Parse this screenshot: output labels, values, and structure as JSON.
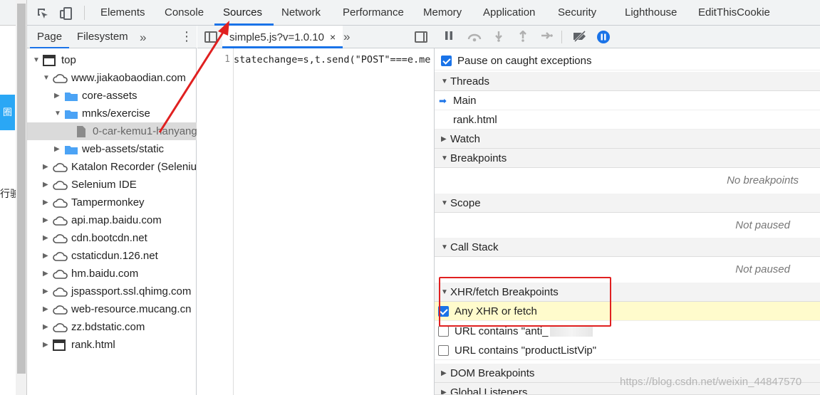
{
  "page_strip": {
    "blue_tab_text": "圈",
    "cut_text": "行驶"
  },
  "main_toolbar": {
    "tabs": [
      "Elements",
      "Console",
      "Sources",
      "Network",
      "Performance",
      "Memory",
      "Application",
      "Security",
      "Lighthouse",
      "EditThisCookie"
    ],
    "active_tab": "Sources"
  },
  "navigator": {
    "tabs": [
      "Page",
      "Filesystem"
    ],
    "active_tab": "Page",
    "more_icon": "»",
    "menu_icon": "⋮",
    "tree": [
      {
        "label": "top",
        "icon": "frame-icon",
        "expanded": true
      },
      {
        "label": "www.jiakaobaodian.com",
        "icon": "cloud-icon",
        "expanded": true
      },
      {
        "label": "core-assets",
        "icon": "folder-icon",
        "expanded": false
      },
      {
        "label": "mnks/exercise",
        "icon": "folder-icon",
        "expanded": true
      },
      {
        "label": "0-car-kemu1-hanyang",
        "icon": "file-icon",
        "selected": true
      },
      {
        "label": "web-assets/static",
        "icon": "folder-icon",
        "expanded": false
      },
      {
        "label": "Katalon Recorder (Selenium",
        "icon": "cloud-icon",
        "expanded": false
      },
      {
        "label": "Selenium IDE",
        "icon": "cloud-icon",
        "expanded": false
      },
      {
        "label": "Tampermonkey",
        "icon": "cloud-icon",
        "expanded": false
      },
      {
        "label": "api.map.baidu.com",
        "icon": "cloud-icon",
        "expanded": false
      },
      {
        "label": "cdn.bootcdn.net",
        "icon": "cloud-icon",
        "expanded": false
      },
      {
        "label": "cstaticdun.126.net",
        "icon": "cloud-icon",
        "expanded": false
      },
      {
        "label": "hm.baidu.com",
        "icon": "cloud-icon",
        "expanded": false
      },
      {
        "label": "jspassport.ssl.qhimg.com",
        "icon": "cloud-icon",
        "expanded": false
      },
      {
        "label": "web-resource.mucang.cn",
        "icon": "cloud-icon",
        "expanded": false
      },
      {
        "label": "zz.bdstatic.com",
        "icon": "cloud-icon",
        "expanded": false
      },
      {
        "label": "rank.html",
        "icon": "frame-icon",
        "expanded": false
      }
    ]
  },
  "editor": {
    "file_tab": "simple5.js?v=1.0.10",
    "close_icon": "×",
    "more_icon": "»",
    "line_number": "1",
    "code": "statechange=s,t.send(\"POST\"===e.me"
  },
  "debugger": {
    "pause_on_caught": {
      "label": "Pause on caught exceptions",
      "checked": true
    },
    "threads": {
      "title": "Threads",
      "items": [
        "Main",
        "rank.html"
      ]
    },
    "watch": {
      "title": "Watch"
    },
    "breakpoints": {
      "title": "Breakpoints",
      "empty": "No breakpoints"
    },
    "scope": {
      "title": "Scope",
      "empty": "Not paused"
    },
    "call_stack": {
      "title": "Call Stack",
      "empty": "Not paused"
    },
    "xhr": {
      "title": "XHR/fetch Breakpoints",
      "items": [
        {
          "label": "Any XHR or fetch",
          "checked": true
        },
        {
          "label": "URL contains \"anti_",
          "checked": false
        },
        {
          "label": "URL contains \"productListVip\"",
          "checked": false
        }
      ]
    },
    "dom_breakpoints": {
      "title": "DOM Breakpoints"
    },
    "global_listeners": {
      "title": "Global Listeners"
    }
  },
  "watermark": "https://blog.csdn.net/weixin_44847570",
  "colors": {
    "accent": "#1a73e8",
    "annotation": "#e02020",
    "highlight": "#fffbcc"
  }
}
